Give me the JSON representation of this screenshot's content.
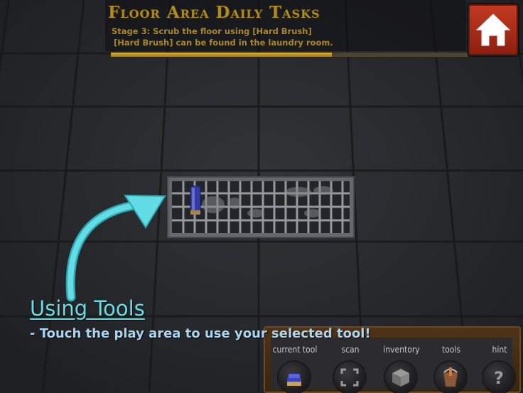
{
  "task": {
    "title": "Floor Area Daily Tasks",
    "line1": "Stage 3: Scrub the floor using [Hard Brush]",
    "line2": "[Hard Brush] can be found in the laundry room.",
    "progress": 0.62
  },
  "tutorial": {
    "title": "Using Tools",
    "text": "- Touch the play area to use your selected tool!"
  },
  "toolbar": [
    {
      "label": "current tool",
      "icon": "brush-icon"
    },
    {
      "label": "scan",
      "icon": "scan-icon"
    },
    {
      "label": "inventory",
      "icon": "box-icon"
    },
    {
      "label": "tools",
      "icon": "bucket-icon"
    },
    {
      "label": "hint",
      "icon": "question-icon"
    }
  ],
  "colors": {
    "accent": "#67dde6",
    "task": "#b08c1e",
    "home": "#c23a22"
  }
}
